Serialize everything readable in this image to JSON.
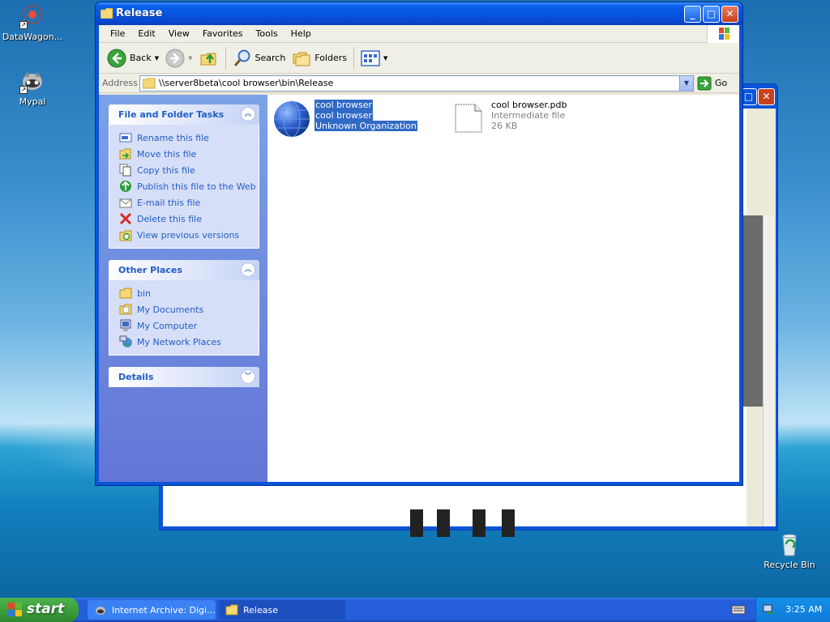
{
  "desktop": {
    "icons": [
      {
        "label": "DataWagon..."
      },
      {
        "label": "Mypal"
      },
      {
        "label": "Recycle Bin"
      }
    ]
  },
  "window": {
    "title": "Release",
    "menu": [
      "File",
      "Edit",
      "View",
      "Favorites",
      "Tools",
      "Help"
    ],
    "toolbar": {
      "back": "Back",
      "search": "Search",
      "folders": "Folders"
    },
    "address": {
      "label": "Address",
      "value": "\\\\server8beta\\cool browser\\bin\\Release",
      "go": "Go"
    }
  },
  "taskpane": {
    "file_tasks": {
      "title": "File and Folder Tasks",
      "items": [
        {
          "label": "Rename this file",
          "icon": "rename-icon"
        },
        {
          "label": "Move this file",
          "icon": "move-icon"
        },
        {
          "label": "Copy this file",
          "icon": "copy-icon"
        },
        {
          "label": "Publish this file to the Web",
          "icon": "publish-icon"
        },
        {
          "label": "E-mail this file",
          "icon": "email-icon"
        },
        {
          "label": "Delete this file",
          "icon": "delete-icon"
        },
        {
          "label": "View previous versions",
          "icon": "versions-icon"
        }
      ]
    },
    "other_places": {
      "title": "Other Places",
      "items": [
        {
          "label": "bin",
          "icon": "folder-icon"
        },
        {
          "label": "My Documents",
          "icon": "my-documents-icon"
        },
        {
          "label": "My Computer",
          "icon": "my-computer-icon"
        },
        {
          "label": "My Network Places",
          "icon": "network-icon"
        }
      ]
    },
    "details": {
      "title": "Details"
    }
  },
  "files": [
    {
      "name": "cool browser",
      "line2": "cool browser",
      "line3": "Unknown Organization",
      "selected": true,
      "icon": "globe-icon"
    },
    {
      "name": "cool browser.pdb",
      "line2": "Intermediate file",
      "line3": "26 KB",
      "selected": false,
      "icon": "generic-file-icon"
    }
  ],
  "taskbar": {
    "start": "start",
    "tasks": [
      {
        "label": "Internet Archive: Digi..."
      },
      {
        "label": "Release"
      }
    ],
    "clock": "3:25 AM"
  },
  "colors": {
    "xp_blue": "#0a54d8",
    "link_blue": "#215dc6",
    "selection": "#316ac5",
    "start_green": "#3c9f3c"
  }
}
